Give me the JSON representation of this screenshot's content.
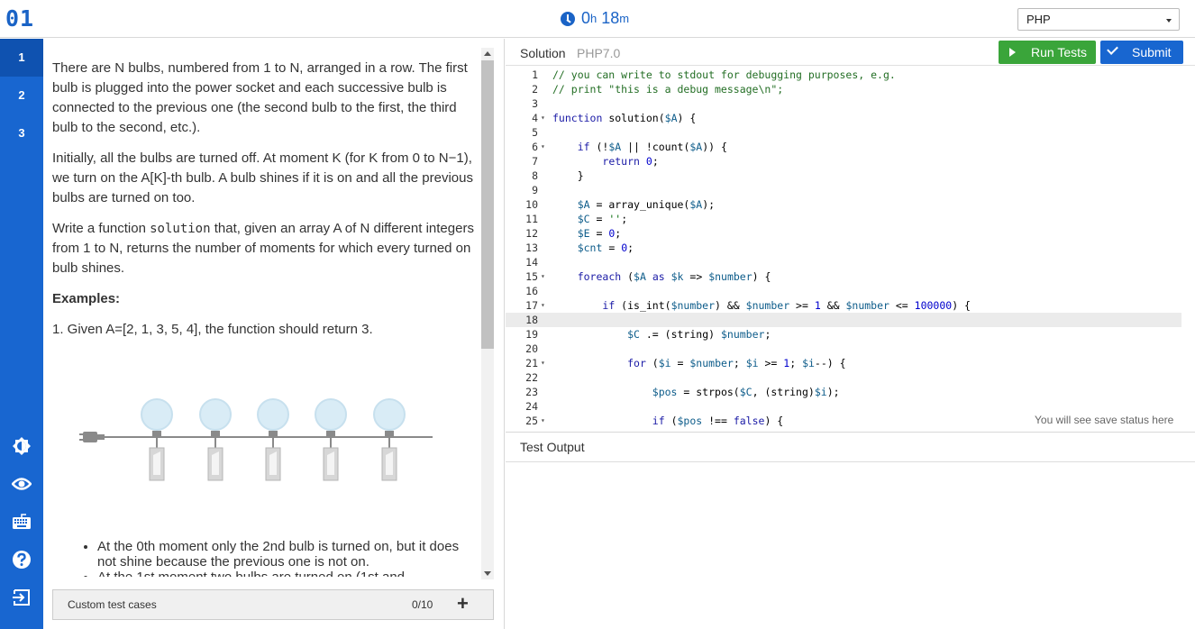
{
  "header": {
    "logo": "01",
    "timer_hours": "0",
    "timer_h_unit": "h",
    "timer_minutes": "18",
    "timer_m_unit": "m",
    "language": "PHP"
  },
  "nav": {
    "items": [
      "1",
      "2",
      "3"
    ],
    "active": "1",
    "icons": [
      "brightness-icon",
      "eye-icon",
      "keyboard-icon",
      "help-icon",
      "exit-icon"
    ]
  },
  "task": {
    "p1": "There are N bulbs, numbered from 1 to N, arranged in a row. The first bulb is plugged into the power socket and each successive bulb is connected to the previous one (the second bulb to the first, the third bulb to the second, etc.).",
    "p2": "Initially, all the bulbs are turned off. At moment K (for K from 0 to N−1), we turn on the A[K]-th bulb. A bulb shines if it is on and all the previous bulbs are turned on too.",
    "p3_pre": "Write a function ",
    "p3_code": "solution",
    "p3_post": " that, given an array A of N different integers from 1 to N, returns the number of moments for which every turned on bulb shines.",
    "examples_heading": "Examples:",
    "example1": "1. Given A=[2, 1, 3, 5, 4], the function should return 3.",
    "bullet1": "At the 0th moment only the 2nd bulb is turned on, but it does not shine because the previous one is not on.",
    "bullet2": "At the 1st moment two bulbs are turned on (1st and"
  },
  "custom_tests": {
    "label": "Custom test cases",
    "count": "0/10",
    "plus": "+"
  },
  "editor": {
    "title": "Solution",
    "version": "PHP7.0",
    "run_label": "Run Tests",
    "submit_label": "Submit",
    "save_status": "You will see save status here",
    "test_output_label": "Test Output",
    "lines": [
      {
        "n": "1",
        "fold": false,
        "tokens": [
          [
            "c-com",
            "// you can write to stdout for debugging purposes, e.g."
          ]
        ]
      },
      {
        "n": "2",
        "fold": false,
        "tokens": [
          [
            "c-com",
            "// print \"this is a debug message\\n\";"
          ]
        ]
      },
      {
        "n": "3",
        "fold": false,
        "tokens": []
      },
      {
        "n": "4",
        "fold": true,
        "tokens": [
          [
            "c-kw",
            "function"
          ],
          [
            "",
            " solution("
          ],
          [
            "c-var",
            "$A"
          ],
          [
            "",
            ") {"
          ]
        ]
      },
      {
        "n": "5",
        "fold": false,
        "tokens": []
      },
      {
        "n": "6",
        "fold": true,
        "tokens": [
          [
            "",
            "    "
          ],
          [
            "c-kw",
            "if"
          ],
          [
            "",
            " (!"
          ],
          [
            "c-var",
            "$A"
          ],
          [
            "",
            " || !count("
          ],
          [
            "c-var",
            "$A"
          ],
          [
            "",
            ")) {"
          ]
        ]
      },
      {
        "n": "7",
        "fold": false,
        "tokens": [
          [
            "",
            "        "
          ],
          [
            "c-kw",
            "return"
          ],
          [
            "",
            " "
          ],
          [
            "c-num",
            "0"
          ],
          [
            "",
            ";"
          ]
        ]
      },
      {
        "n": "8",
        "fold": false,
        "tokens": [
          [
            "",
            "    }"
          ]
        ]
      },
      {
        "n": "9",
        "fold": false,
        "tokens": []
      },
      {
        "n": "10",
        "fold": false,
        "tokens": [
          [
            "",
            "    "
          ],
          [
            "c-var",
            "$A"
          ],
          [
            "",
            " = array_unique("
          ],
          [
            "c-var",
            "$A"
          ],
          [
            "",
            ");"
          ]
        ]
      },
      {
        "n": "11",
        "fold": false,
        "tokens": [
          [
            "",
            "    "
          ],
          [
            "c-var",
            "$C"
          ],
          [
            "",
            " = "
          ],
          [
            "c-str",
            "''"
          ],
          [
            "",
            ";"
          ]
        ]
      },
      {
        "n": "12",
        "fold": false,
        "tokens": [
          [
            "",
            "    "
          ],
          [
            "c-var",
            "$E"
          ],
          [
            "",
            " = "
          ],
          [
            "c-num",
            "0"
          ],
          [
            "",
            ";"
          ]
        ]
      },
      {
        "n": "13",
        "fold": false,
        "tokens": [
          [
            "",
            "    "
          ],
          [
            "c-var",
            "$cnt"
          ],
          [
            "",
            " = "
          ],
          [
            "c-num",
            "0"
          ],
          [
            "",
            ";"
          ]
        ]
      },
      {
        "n": "14",
        "fold": false,
        "tokens": []
      },
      {
        "n": "15",
        "fold": true,
        "tokens": [
          [
            "",
            "    "
          ],
          [
            "c-kw",
            "foreach"
          ],
          [
            "",
            " ("
          ],
          [
            "c-var",
            "$A"
          ],
          [
            "",
            " "
          ],
          [
            "c-kw",
            "as"
          ],
          [
            "",
            " "
          ],
          [
            "c-var",
            "$k"
          ],
          [
            "",
            " => "
          ],
          [
            "c-var",
            "$number"
          ],
          [
            "",
            ") {"
          ]
        ]
      },
      {
        "n": "16",
        "fold": false,
        "tokens": []
      },
      {
        "n": "17",
        "fold": true,
        "tokens": [
          [
            "",
            "        "
          ],
          [
            "c-kw",
            "if"
          ],
          [
            "",
            " (is_int("
          ],
          [
            "c-var",
            "$number"
          ],
          [
            "",
            ") && "
          ],
          [
            "c-var",
            "$number"
          ],
          [
            "",
            " >= "
          ],
          [
            "c-num",
            "1"
          ],
          [
            "",
            " && "
          ],
          [
            "c-var",
            "$number"
          ],
          [
            "",
            " <= "
          ],
          [
            "c-num",
            "100000"
          ],
          [
            "",
            ") {"
          ]
        ]
      },
      {
        "n": "18",
        "fold": false,
        "tokens": [],
        "highlight": true
      },
      {
        "n": "19",
        "fold": false,
        "tokens": [
          [
            "",
            "            "
          ],
          [
            "c-var",
            "$C"
          ],
          [
            "",
            " .= (string) "
          ],
          [
            "c-var",
            "$number"
          ],
          [
            "",
            ";"
          ]
        ]
      },
      {
        "n": "20",
        "fold": false,
        "tokens": []
      },
      {
        "n": "21",
        "fold": true,
        "tokens": [
          [
            "",
            "            "
          ],
          [
            "c-kw",
            "for"
          ],
          [
            "",
            " ("
          ],
          [
            "c-var",
            "$i"
          ],
          [
            "",
            " = "
          ],
          [
            "c-var",
            "$number"
          ],
          [
            "",
            "; "
          ],
          [
            "c-var",
            "$i"
          ],
          [
            "",
            " >= "
          ],
          [
            "c-num",
            "1"
          ],
          [
            "",
            "; "
          ],
          [
            "c-var",
            "$i"
          ],
          [
            "",
            "--) {"
          ]
        ]
      },
      {
        "n": "22",
        "fold": false,
        "tokens": []
      },
      {
        "n": "23",
        "fold": false,
        "tokens": [
          [
            "",
            "                "
          ],
          [
            "c-var",
            "$pos"
          ],
          [
            "",
            " = strpos("
          ],
          [
            "c-var",
            "$C"
          ],
          [
            "",
            ", (string)"
          ],
          [
            "c-var",
            "$i"
          ],
          [
            "",
            ");"
          ]
        ]
      },
      {
        "n": "24",
        "fold": false,
        "tokens": []
      },
      {
        "n": "25",
        "fold": true,
        "tokens": [
          [
            "",
            "                "
          ],
          [
            "c-kw",
            "if"
          ],
          [
            "",
            " ("
          ],
          [
            "c-var",
            "$pos"
          ],
          [
            "",
            " !== "
          ],
          [
            "c-kw",
            "false"
          ],
          [
            "",
            ") {"
          ]
        ]
      }
    ]
  }
}
